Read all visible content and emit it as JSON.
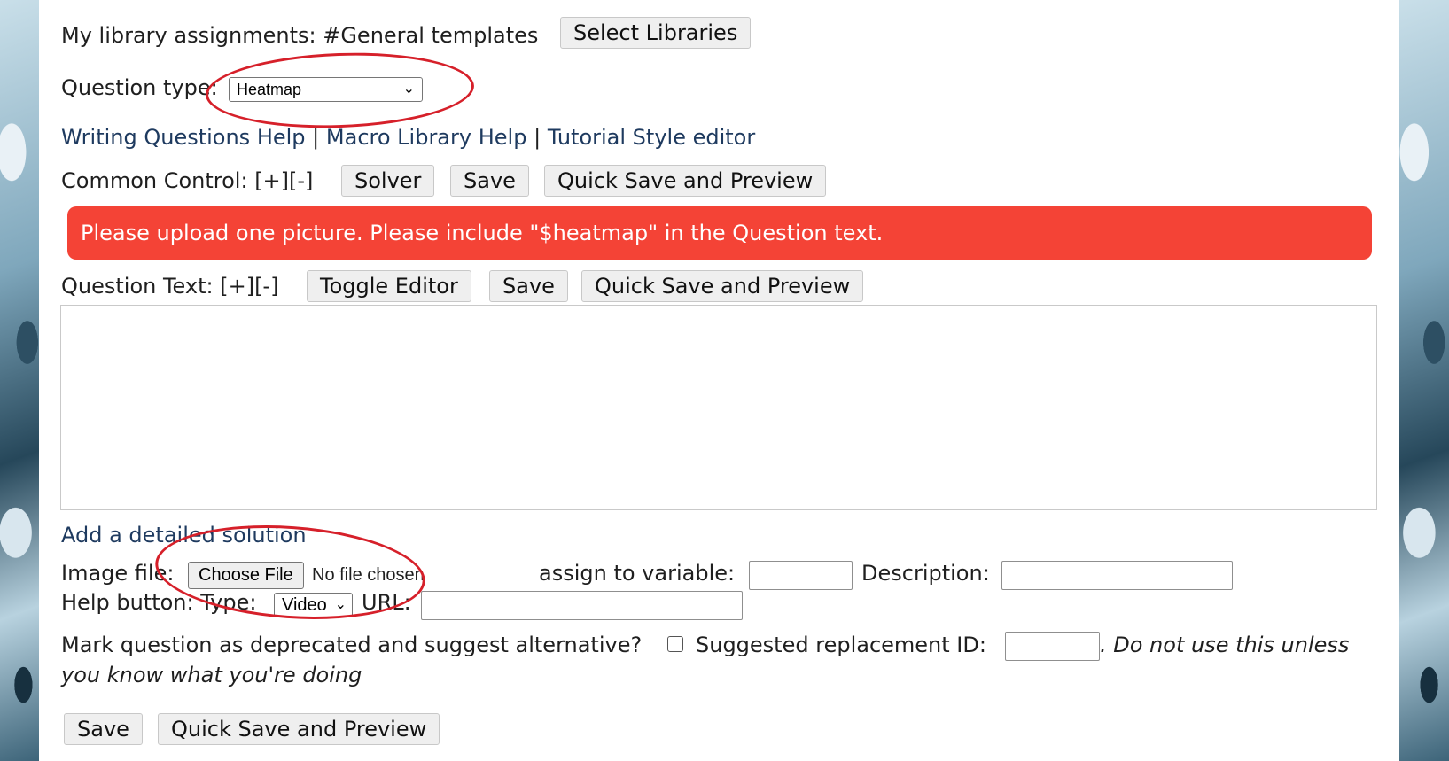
{
  "library": {
    "label": "My library assignments:",
    "value": "#General templates",
    "button": "Select Libraries"
  },
  "question_type": {
    "label": "Question type:",
    "selected": "Heatmap"
  },
  "help_links": {
    "writing": "Writing Questions Help",
    "sep1": "|",
    "macro": "Macro Library Help",
    "sep2": "|",
    "tutorial": "Tutorial Style editor"
  },
  "common_control": {
    "label": "Common Control: [+][-]",
    "solver": "Solver",
    "save": "Save",
    "quick_save": "Quick Save and Preview"
  },
  "alert": {
    "text": "Please upload one picture. Please include \"$heatmap\" in the Question text."
  },
  "question_text": {
    "label": "Question Text: [+][-]",
    "toggle": "Toggle Editor",
    "save": "Save",
    "quick_save": "Quick Save and Preview"
  },
  "solution_link": "Add a detailed solution",
  "image_file": {
    "label": "Image file:",
    "choose": "Choose File",
    "status": "No file chosen",
    "assign_label": "assign to variable:",
    "description_label": "Description:"
  },
  "help_button": {
    "label": "Help button: Type:",
    "type_selected": "Video",
    "url_label": "URL:"
  },
  "deprecated": {
    "label": "Mark question as deprecated and suggest alternative?",
    "replacement_label": "Suggested replacement ID:",
    "warning_part1": ". Do not use this unless",
    "warning_part2": "you know what you're doing"
  },
  "footer": {
    "save": "Save",
    "quick_save": "Quick Save and Preview"
  },
  "colors": {
    "alert": "#f44336",
    "annotation": "#d6202a",
    "link": "#1e3a5f"
  }
}
